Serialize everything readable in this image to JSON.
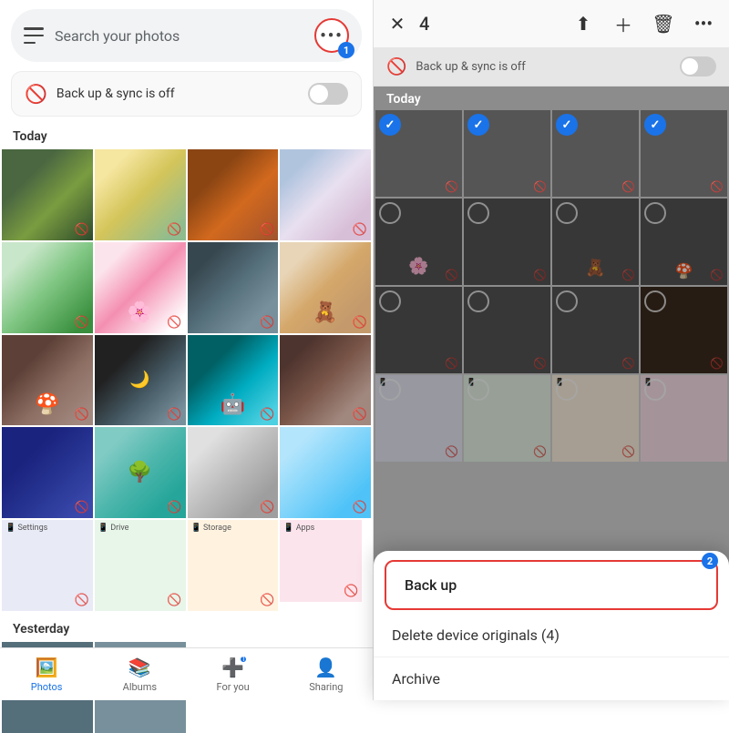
{
  "left": {
    "search_placeholder": "Search your photos",
    "more_menu_dots": "•••",
    "badge1": "1",
    "sync_text": "Back up & sync is off",
    "section_today": "Today",
    "section_yesterday": "Yesterday",
    "photos": [
      {
        "id": "p1",
        "class": "p1"
      },
      {
        "id": "p2",
        "class": "p2"
      },
      {
        "id": "p3",
        "class": "p3"
      },
      {
        "id": "p4",
        "class": "p4"
      },
      {
        "id": "p5",
        "class": "p5"
      },
      {
        "id": "p6",
        "class": "p6"
      },
      {
        "id": "p7",
        "class": "p7"
      },
      {
        "id": "p8",
        "class": "p8"
      },
      {
        "id": "p9",
        "class": "p9"
      },
      {
        "id": "p10",
        "class": "p10"
      },
      {
        "id": "p11",
        "class": "p11"
      },
      {
        "id": "p12",
        "class": "p12"
      },
      {
        "id": "p13",
        "class": "p13"
      },
      {
        "id": "p14",
        "class": "p14"
      },
      {
        "id": "p15",
        "class": "p15"
      },
      {
        "id": "p16",
        "class": "p16"
      },
      {
        "id": "p17",
        "class": "screenshot-cell"
      },
      {
        "id": "p18",
        "class": "screenshot-cell"
      },
      {
        "id": "p19",
        "class": "screenshot-cell"
      },
      {
        "id": "p20",
        "class": "screenshot-cell"
      }
    ],
    "nav": [
      {
        "id": "photos",
        "label": "Photos",
        "icon": "🖼️",
        "active": true
      },
      {
        "id": "albums",
        "label": "Albums",
        "icon": "📚",
        "active": false
      },
      {
        "id": "foryou",
        "label": "For you",
        "icon": "➕",
        "active": false,
        "badge": "1"
      },
      {
        "id": "sharing",
        "label": "Sharing",
        "icon": "👤",
        "active": false
      }
    ]
  },
  "right": {
    "close_icon": "✕",
    "selected_count": "4",
    "actions": [
      "⬆",
      "＋",
      "🗑",
      "•••"
    ],
    "sync_text": "Back up & sync is off",
    "section_today": "Today",
    "photos_row1": [
      {
        "class": "p1",
        "checked": true
      },
      {
        "class": "p3",
        "checked": true
      },
      {
        "class": "p4",
        "checked": true
      },
      {
        "class": "p5",
        "checked": true
      }
    ],
    "photos_row2": [
      {
        "class": "p6",
        "checked": false
      },
      {
        "class": "p7",
        "checked": false
      },
      {
        "class": "p8",
        "checked": false
      },
      {
        "class": "p9",
        "checked": false
      }
    ],
    "photos_row3": [
      {
        "class": "p10",
        "checked": false
      },
      {
        "class": "p11",
        "checked": false
      },
      {
        "class": "p12",
        "checked": false
      },
      {
        "class": "p9",
        "checked": false
      }
    ],
    "photos_row4": [
      {
        "class": "p13",
        "checked": false
      },
      {
        "class": "p14",
        "checked": false
      },
      {
        "class": "p15",
        "checked": false
      },
      {
        "class": "p16",
        "checked": false
      }
    ],
    "action_sheet": {
      "backup_label": "Back up",
      "delete_label": "Delete device originals (4)",
      "archive_label": "Archive",
      "badge2": "2"
    }
  }
}
